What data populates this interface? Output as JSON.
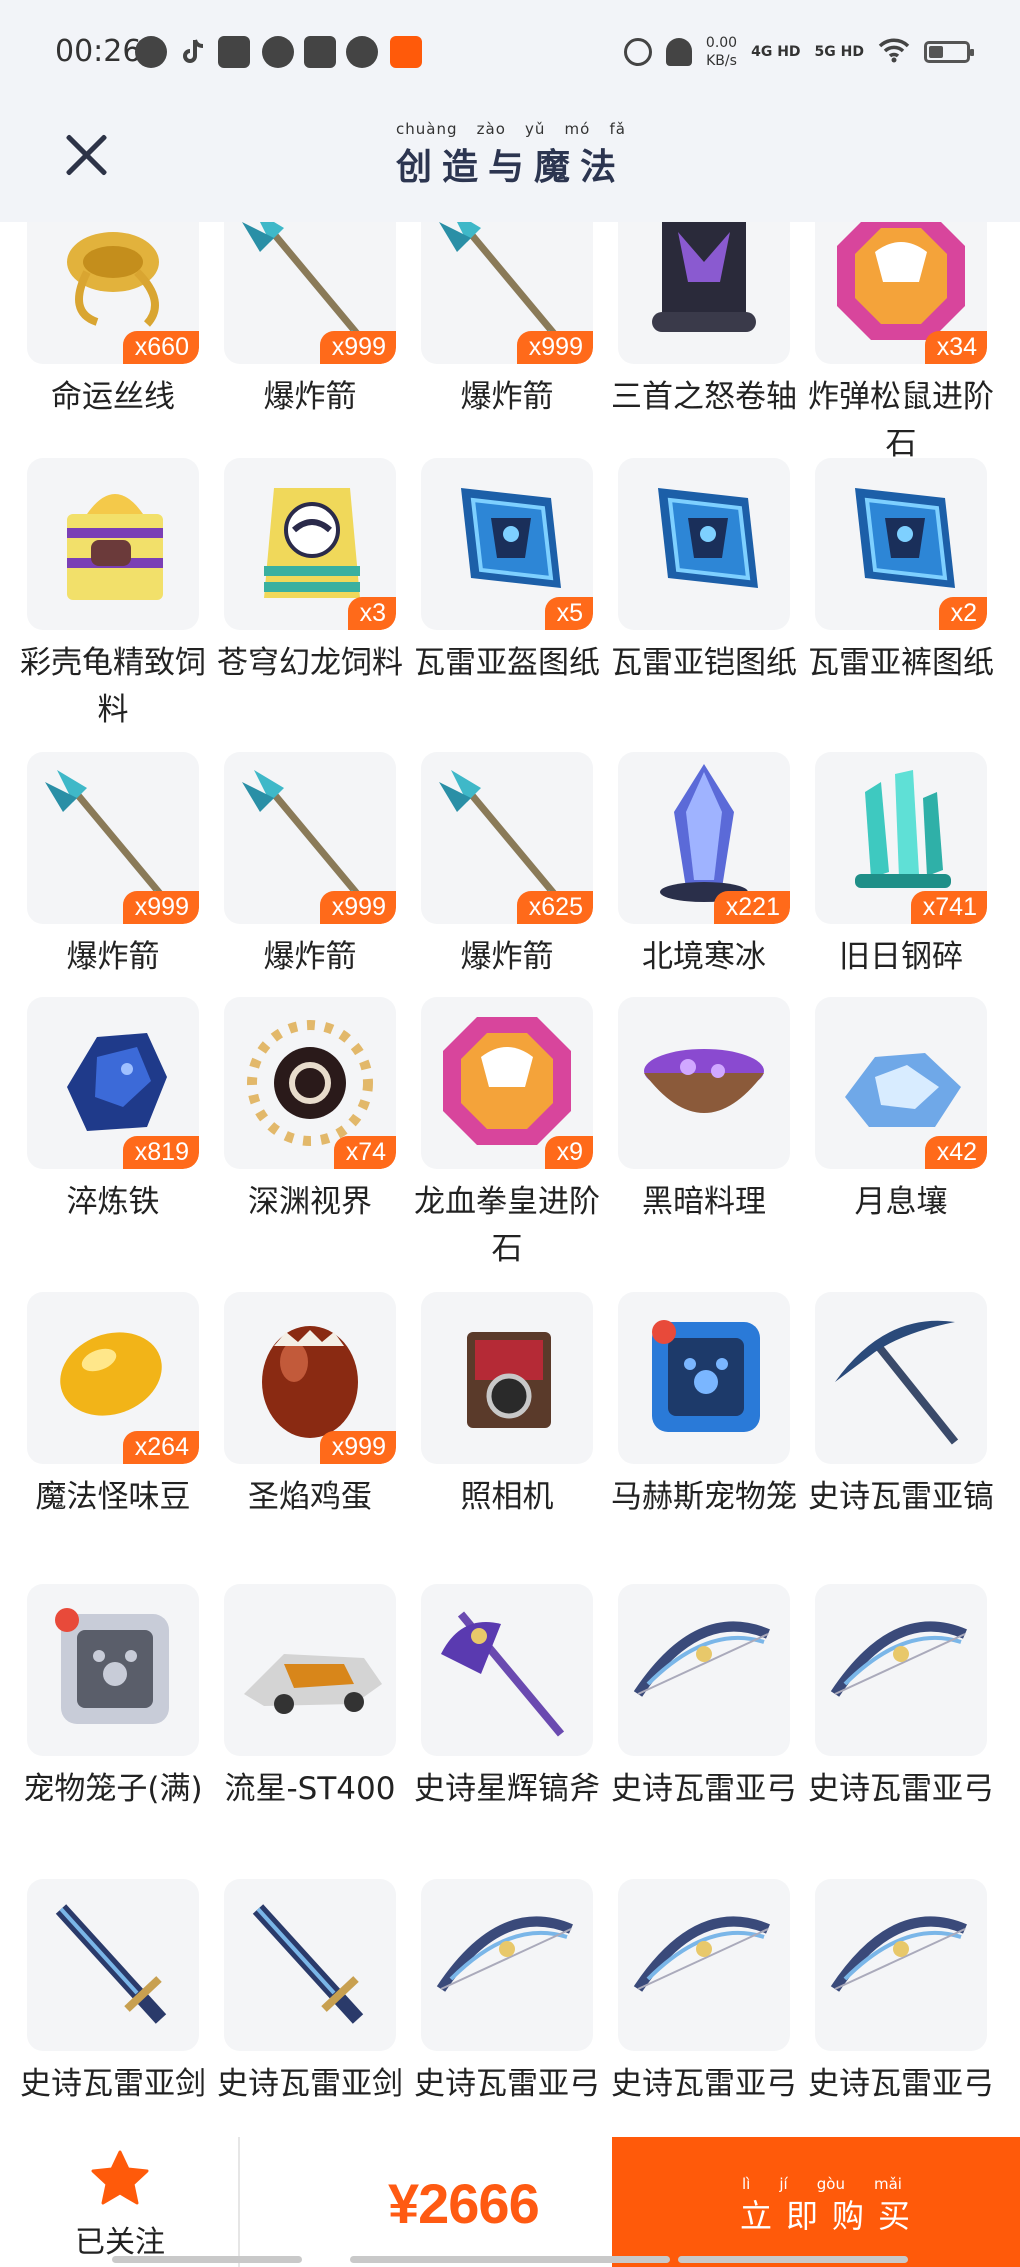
{
  "status_bar": {
    "time": "00:26",
    "net_speed": "0.00",
    "net_unit": "KB/s",
    "sig1": "4G HD",
    "sig2": "5G HD"
  },
  "header": {
    "logo_pinyin": [
      "chuàng",
      "zào",
      "yǔ",
      "mó",
      "fǎ"
    ],
    "logo_text": "创造与魔法"
  },
  "colors": {
    "accent": "#ff5a0a",
    "badge": "#ff6a1a",
    "price": "#ff5a12",
    "header_bg": "#f2f4f8"
  },
  "items": [
    {
      "name": "命运丝线",
      "qty": "x660",
      "icon": "golden-rope-icon"
    },
    {
      "name": "爆炸箭",
      "qty": "x999",
      "icon": "arrow-icon"
    },
    {
      "name": "爆炸箭",
      "qty": "x999",
      "icon": "arrow-icon"
    },
    {
      "name": "三首之怒卷轴",
      "qty": "",
      "icon": "scroll-icon"
    },
    {
      "name": "炸弹松鼠进阶石",
      "qty": "x34",
      "icon": "gem-icon"
    },
    {
      "name": "彩壳龟精致饲料",
      "qty": "",
      "icon": "gift-box-icon"
    },
    {
      "name": "苍穹幻龙饲料",
      "qty": "x3",
      "icon": "feed-bag-icon"
    },
    {
      "name": "瓦雷亚盔图纸",
      "qty": "x5",
      "icon": "blueprint-icon"
    },
    {
      "name": "瓦雷亚铠图纸",
      "qty": "",
      "icon": "blueprint-icon"
    },
    {
      "name": "瓦雷亚裤图纸",
      "qty": "x2",
      "icon": "blueprint-icon"
    },
    {
      "name": "爆炸箭",
      "qty": "x999",
      "icon": "arrow-icon"
    },
    {
      "name": "爆炸箭",
      "qty": "x999",
      "icon": "arrow-icon"
    },
    {
      "name": "爆炸箭",
      "qty": "x625",
      "icon": "arrow-icon"
    },
    {
      "name": "北境寒冰",
      "qty": "x221",
      "icon": "ice-crystal-icon"
    },
    {
      "name": "旧日钢碎",
      "qty": "x741",
      "icon": "steel-shard-icon"
    },
    {
      "name": "淬炼铁",
      "qty": "x819",
      "icon": "iron-ore-icon"
    },
    {
      "name": "深渊视界",
      "qty": "x74",
      "icon": "abyss-eye-icon"
    },
    {
      "name": "龙血拳皇进阶石",
      "qty": "x9",
      "icon": "gem-icon"
    },
    {
      "name": "黑暗料理",
      "qty": "",
      "icon": "dark-food-bowl-icon"
    },
    {
      "name": "月息壤",
      "qty": "x42",
      "icon": "moon-soil-icon"
    },
    {
      "name": "魔法怪味豆",
      "qty": "x264",
      "icon": "magic-bean-icon"
    },
    {
      "name": "圣焰鸡蛋",
      "qty": "x999",
      "icon": "egg-icon"
    },
    {
      "name": "照相机",
      "qty": "",
      "icon": "camera-icon"
    },
    {
      "name": "马赫斯宠物笼",
      "qty": "",
      "icon": "pet-cage-icon"
    },
    {
      "name": "史诗瓦雷亚镐",
      "qty": "",
      "icon": "pickaxe-icon"
    },
    {
      "name": "宠物笼子(满)",
      "qty": "",
      "icon": "pet-cage-full-icon"
    },
    {
      "name": "流星-ST400",
      "qty": "",
      "icon": "vehicle-icon"
    },
    {
      "name": "史诗星辉镐斧",
      "qty": "",
      "icon": "axe-icon"
    },
    {
      "name": "史诗瓦雷亚弓",
      "qty": "",
      "icon": "bow-icon"
    },
    {
      "name": "史诗瓦雷亚弓",
      "qty": "",
      "icon": "bow-icon"
    },
    {
      "name": "史诗瓦雷亚剑",
      "qty": "",
      "icon": "sword-icon"
    },
    {
      "name": "史诗瓦雷亚剑",
      "qty": "",
      "icon": "sword-icon"
    },
    {
      "name": "史诗瓦雷亚弓",
      "qty": "",
      "icon": "bow-icon"
    },
    {
      "name": "史诗瓦雷亚弓",
      "qty": "",
      "icon": "bow-icon"
    },
    {
      "name": "史诗瓦雷亚弓",
      "qty": "",
      "icon": "bow-icon"
    }
  ],
  "bottom_bar": {
    "follow_label": "已关注",
    "price": "¥2666",
    "buy_pinyin": [
      "lì",
      "jí",
      "gòu",
      "mǎi"
    ],
    "buy_label": "立即购买"
  }
}
